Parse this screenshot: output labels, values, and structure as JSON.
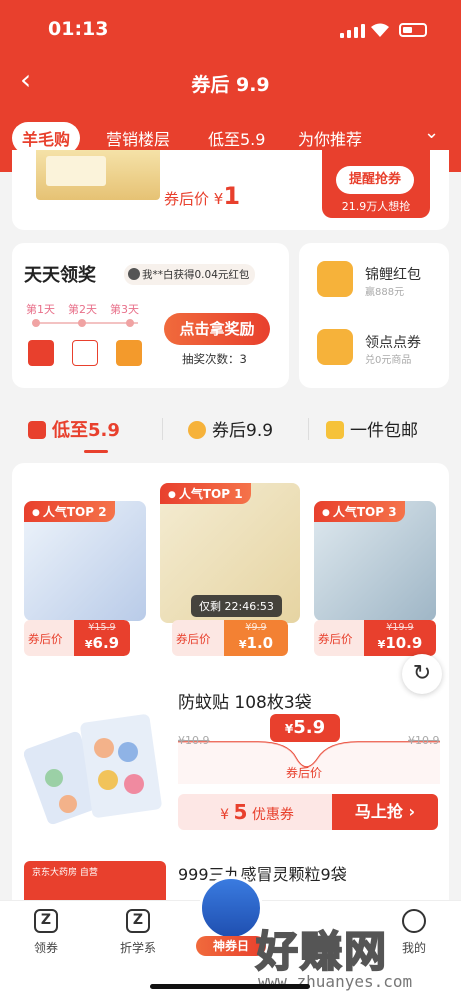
{
  "status": {
    "time": "01:13"
  },
  "nav": {
    "back": "‹",
    "title": "券后 9.9"
  },
  "tabs": [
    "羊毛购",
    "营销楼层",
    "低至5.9",
    "为你推荐"
  ],
  "top_card": {
    "price_label": "券后价 ¥",
    "price": "1",
    "remind_button": "提醒抢券",
    "want_count": "21.9万人想抢"
  },
  "daily": {
    "title": "天天领奖",
    "winner": "我**白获得0.04元红包",
    "days": [
      "第1天",
      "第2天",
      "第3天"
    ],
    "button": "点击拿奖励",
    "draw_count": "抽奖次数：3"
  },
  "side": {
    "items": [
      {
        "title": "锦鲤红包",
        "sub": "赢888元"
      },
      {
        "title": "领点点券",
        "sub": "兑0元商品"
      }
    ]
  },
  "segments": [
    "低至5.9",
    "券后9.9",
    "一件包邮"
  ],
  "top3": [
    {
      "badge": "人气TOP 2",
      "label": "券后价",
      "old": "¥15.9",
      "now_sym": "¥",
      "now": "6.9"
    },
    {
      "badge": "人气TOP 1",
      "label": "券后价",
      "old": "¥9.9",
      "now_sym": "¥",
      "now": "1.0"
    },
    {
      "badge": "人气TOP 3",
      "label": "券后价",
      "old": "¥19.9",
      "now_sym": "¥",
      "now": "10.9"
    }
  ],
  "countdown": "仅剩 22:46:53",
  "product1": {
    "name": "防蚊贴 108枚3袋",
    "old_left": "¥10.9",
    "old_right": "¥10.9",
    "new_sym": "¥",
    "new_price": "5.9",
    "after_label": "券后价",
    "coupon_sym": "¥",
    "coupon_value": "5",
    "coupon_label": "优惠券",
    "grab": "马上抢 ›"
  },
  "product2": {
    "name": "999三九感冒灵颗粒9袋",
    "store": "京东大药房 自营"
  },
  "bottom_nav": [
    "领券",
    "折学系",
    "神券日",
    "我的"
  ],
  "watermark": {
    "brand": "好赚网",
    "url": "www.zhuanyes.com"
  },
  "colors": {
    "brand_red": "#e8402d",
    "orange": "#f38133"
  }
}
